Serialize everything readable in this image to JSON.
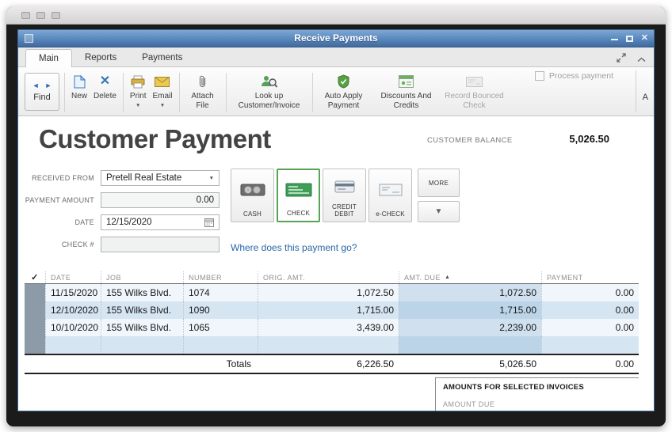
{
  "window": {
    "title": "Receive Payments"
  },
  "tabs": {
    "main": "Main",
    "reports": "Reports",
    "payments": "Payments"
  },
  "toolbar": {
    "find": "Find",
    "new": "New",
    "delete": "Delete",
    "print": "Print",
    "email": "Email",
    "attach_file": "Attach File",
    "lookup": "Look up Customer/Invoice",
    "auto_apply": "Auto Apply Payment",
    "discounts": "Discounts And Credits",
    "bounced": "Record Bounced Check",
    "process_payment": "Process payment",
    "edge_label": "A"
  },
  "header": {
    "title": "Customer Payment",
    "customer_balance_label": "CUSTOMER BALANCE",
    "customer_balance_value": "5,026.50"
  },
  "form": {
    "received_from_label": "RECEIVED FROM",
    "received_from_value": "Pretell Real Estate",
    "payment_amount_label": "PAYMENT AMOUNT",
    "payment_amount_value": "0.00",
    "date_label": "DATE",
    "date_value": "12/15/2020",
    "check_label": "CHECK #",
    "check_value": ""
  },
  "payment_methods": {
    "cash": "CASH",
    "check": "CHECK",
    "credit_debit": "CREDIT DEBIT",
    "echeck": "e-CHECK",
    "more": "MORE"
  },
  "link": "Where does this payment go?",
  "table": {
    "headers": {
      "date": "DATE",
      "job": "JOB",
      "number": "NUMBER",
      "orig": "ORIG. AMT.",
      "due": "AMT. DUE",
      "payment": "PAYMENT"
    },
    "rows": [
      {
        "date": "11/15/2020",
        "job": "155 Wilks Blvd.",
        "number": "1074",
        "orig": "1,072.50",
        "due": "1,072.50",
        "payment": "0.00"
      },
      {
        "date": "12/10/2020",
        "job": "155 Wilks Blvd.",
        "number": "1090",
        "orig": "1,715.00",
        "due": "1,715.00",
        "payment": "0.00"
      },
      {
        "date": "10/10/2020",
        "job": "155 Wilks Blvd.",
        "number": "1065",
        "orig": "3,439.00",
        "due": "2,239.00",
        "payment": "0.00"
      }
    ],
    "totals_label": "Totals",
    "totals": {
      "orig": "6,226.50",
      "due": "5,026.50",
      "payment": "0.00"
    }
  },
  "selected_invoices": {
    "title": "AMOUNTS FOR SELECTED INVOICES",
    "amount_due_label": "AMOUNT DUE"
  },
  "icons": {
    "back_arrow": "◄",
    "forward_arrow": "►",
    "caret_down": "▼",
    "dropdown_arrow": "▼",
    "sort_ascending": "▲",
    "header_checkmark": "✓",
    "more_down_arrow": "▼",
    "close_glyph": "✕",
    "delete_glyph": "✕"
  },
  "colors": {
    "titlebar_blue": "#5b8abf",
    "selected_method_green": "#58a457",
    "row_alt_blue": "#d5e5f2",
    "check_column_gray": "#8d9aa7",
    "link_blue": "#2a67a8"
  }
}
